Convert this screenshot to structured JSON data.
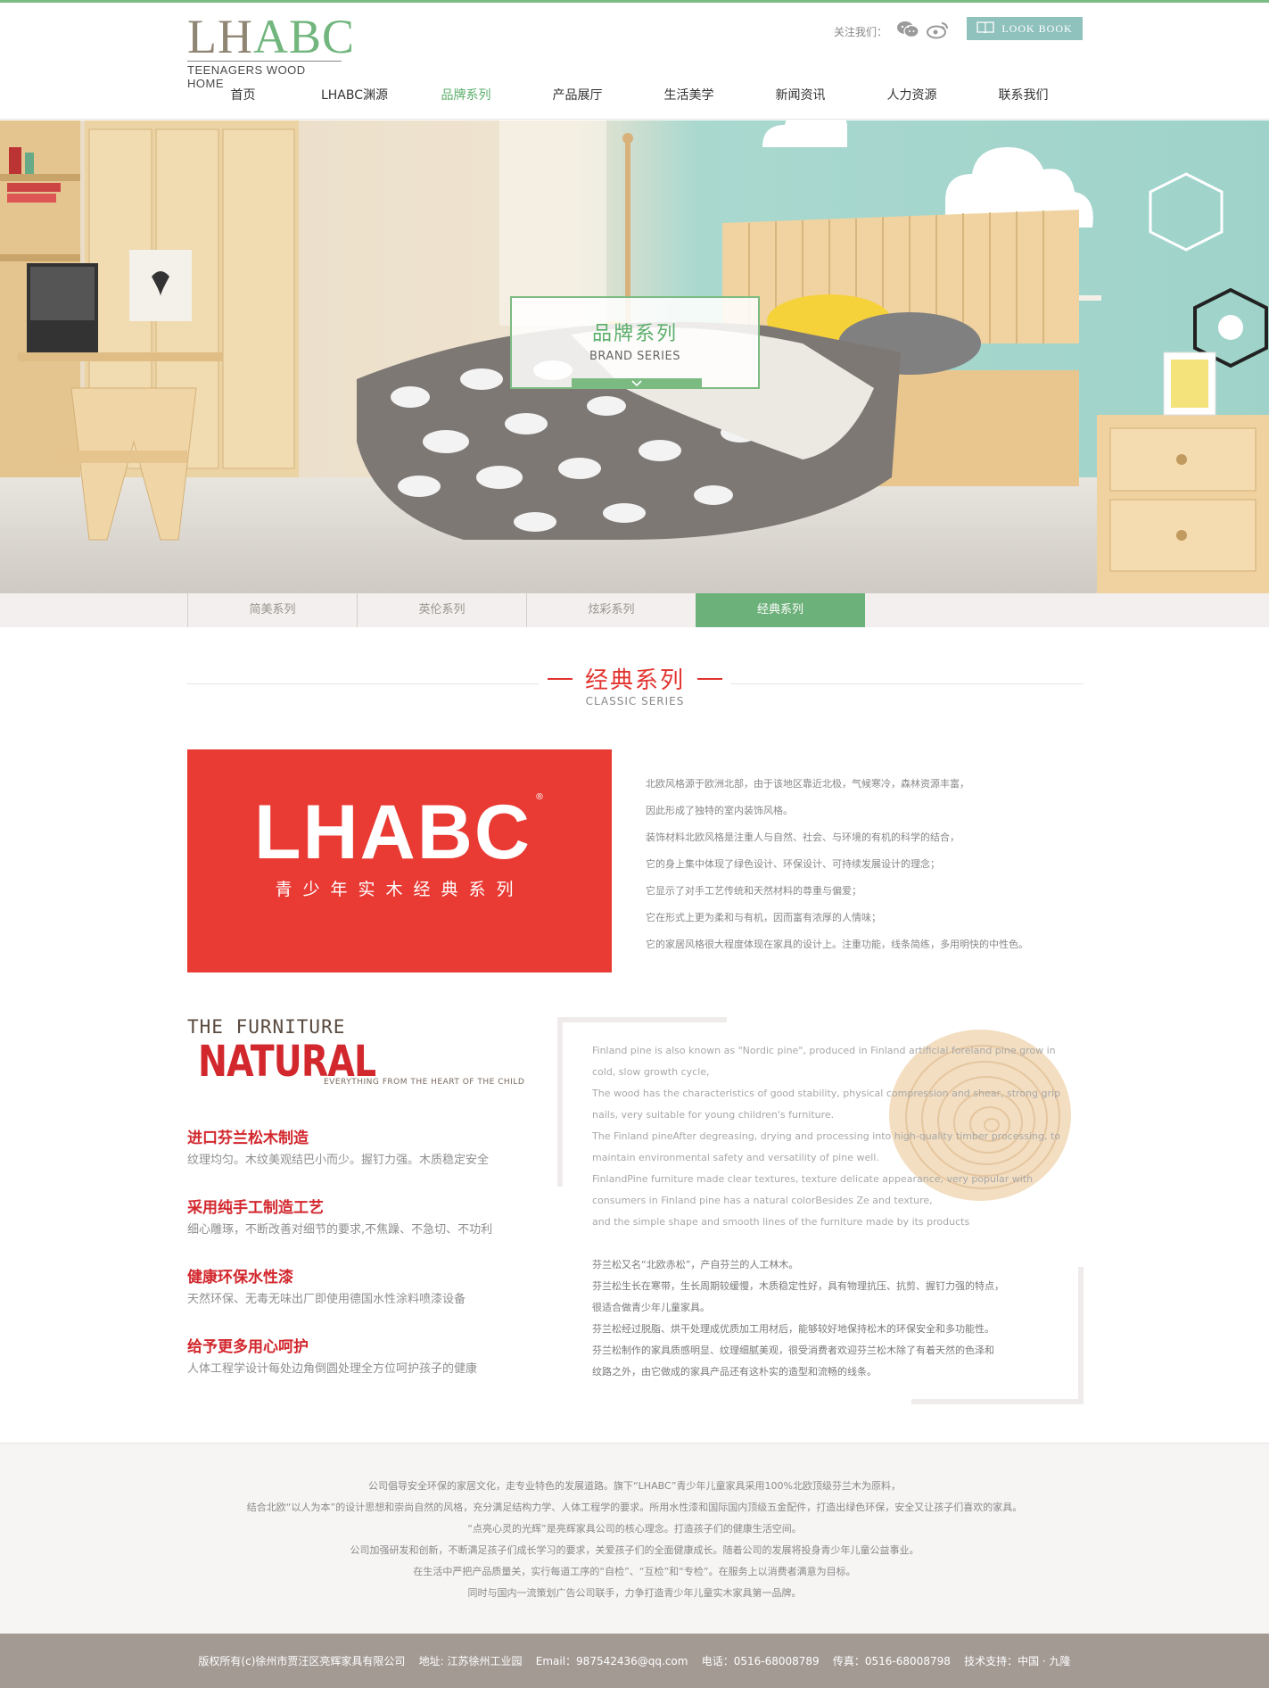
{
  "header": {
    "logo": {
      "main_a": "LH",
      "main_b": "ABC",
      "sub": "TEENAGERS WOOD HOME"
    },
    "follow_label": "关注我们：",
    "social": [
      "wechat-icon",
      "weibo-icon"
    ],
    "lookbook_label": "LOOK BOOK",
    "nav": [
      "首页",
      "LHABC渊源",
      "品牌系列",
      "产品展厅",
      "生活美学",
      "新闻资讯",
      "人力资源",
      "联系我们"
    ],
    "active_nav": "品牌系列"
  },
  "banner": {
    "title_cn": "品牌系列",
    "title_en": "BRAND SERIES"
  },
  "tabs": [
    "简美系列",
    "英伦系列",
    "炫彩系列",
    "经典系列"
  ],
  "active_tab": "经典系列",
  "section": {
    "title_cn": "经典系列",
    "title_en": "CLASSIC SERIES"
  },
  "brand_panel": {
    "logo": "LHABC",
    "reg": "®",
    "subtitle": "青少年实木经典系列"
  },
  "intro_lines": [
    "北欧风格源于欧洲北部，由于该地区靠近北极，气候寒冷，森林资源丰富，",
    "因此形成了独特的室内装饰风格。",
    "装饰材料北欧风格是注重人与自然、社会、与环境的有机的科学的结合，",
    "它的身上集中体现了绿色设计、环保设计、可持续发展设计的理念；",
    "它显示了对手工艺传统和天然材料的尊重与偏爱；",
    "它在形式上更为柔和与有机，因而富有浓厚的人情味；",
    "它的家居风格很大程度体现在家具的设计上。注重功能，线条简练，多用明快的中性色。"
  ],
  "natural": {
    "line1": "THE FURNITURE",
    "line2": "NATURAL",
    "line3": "EVERYTHING FROM THE HEART OF THE CHILD"
  },
  "features": [
    {
      "title": "进口芬兰松木制造",
      "desc": "纹理均匀。木纹美观结巴小而少。握钉力强。木质稳定安全"
    },
    {
      "title": "采用纯手工制造工艺",
      "desc": "细心雕琢，不断改善对细节的要求,不焦躁、不急切、不功利"
    },
    {
      "title": "健康环保水性漆",
      "desc": "天然环保、无毒无味出厂即使用德国水性涂料喷漆设备"
    },
    {
      "title": "给予更多用心呵护",
      "desc": "人体工程学设计每处边角倒圆处理全方位呵护孩子的健康"
    }
  ],
  "en_lines": [
    "Finland pine is also known as \"Nordic pine\", produced in Finland artificial foreland pine grow in",
    "cold, slow growth cycle,",
    "The wood has the characteristics of good stability, physical compression and shear, strong grip",
    "nails, very suitable for young children's furniture.",
    "The Finland pineAfter degreasing, drying and processing into high-quality timber processing, to",
    "maintain environmental safety and versatility of pine well.",
    "FinlandPine furniture made clear textures, texture delicate appearance, very popular with",
    "consumers in Finland pine has a natural colorBesides Ze and texture,",
    "and the simple shape and smooth lines of the furniture made by its products"
  ],
  "cn_lines": [
    "芬兰松又名“北欧赤松”，产自芬兰的人工林木。",
    "芬兰松生长在寒带，生长周期较缓慢，木质稳定性好，具有物理抗压、抗剪、握钉力强的特点，",
    "很适合做青少年儿童家具。",
    "芬兰松经过脱脂、烘干处理成优质加工用材后，能够较好地保持松木的环保安全和多功能性。",
    "芬兰松制作的家具质感明显、纹理细腻美观，很受消费者欢迎芬兰松木除了有着天然的色泽和",
    "纹路之外，由它做成的家具产品还有这朴实的造型和流畅的线条。"
  ],
  "footer_info": [
    "公司倡导安全环保的家居文化，走专业特色的发展道路。旗下“LHABC”青少年儿童家具采用100%北欧顶级芬兰木为原料，",
    "结合北欧“以人为本”的设计思想和崇尚自然的风格，充分满足结构力学、人体工程学的要求。所用水性漆和国际国内顶级五金配件，打造出绿色环保，安全又让孩子们喜欢的家具。",
    "“点亮心灵的光辉”是亮辉家具公司的核心理念。打造孩子们的健康生活空间。",
    "公司加强研发和创新，不断满足孩子们成长学习的要求，关爱孩子们的全面健康成长。随着公司的发展将投身青少年儿童公益事业。",
    "在生活中严把产品质量关，实行每道工序的“自检”、“互检”和“专检”。在服务上以消费者满意为目标。",
    "同时与国内一流策划广告公司联手，力争打造青少年儿童实木家具第一品牌。"
  ],
  "footer_bar": "版权所有(c)徐州市贾汪区亮辉家具有限公司    地址: 江苏徐州工业园    Email：987542436@qq.com    电话：0516-68008789    传真：0516-68008798    技术支持：中国 · 九隆",
  "colors": {
    "accent": "#6db17a",
    "brand_red": "#e93a34",
    "title_red": "#e2342f"
  }
}
